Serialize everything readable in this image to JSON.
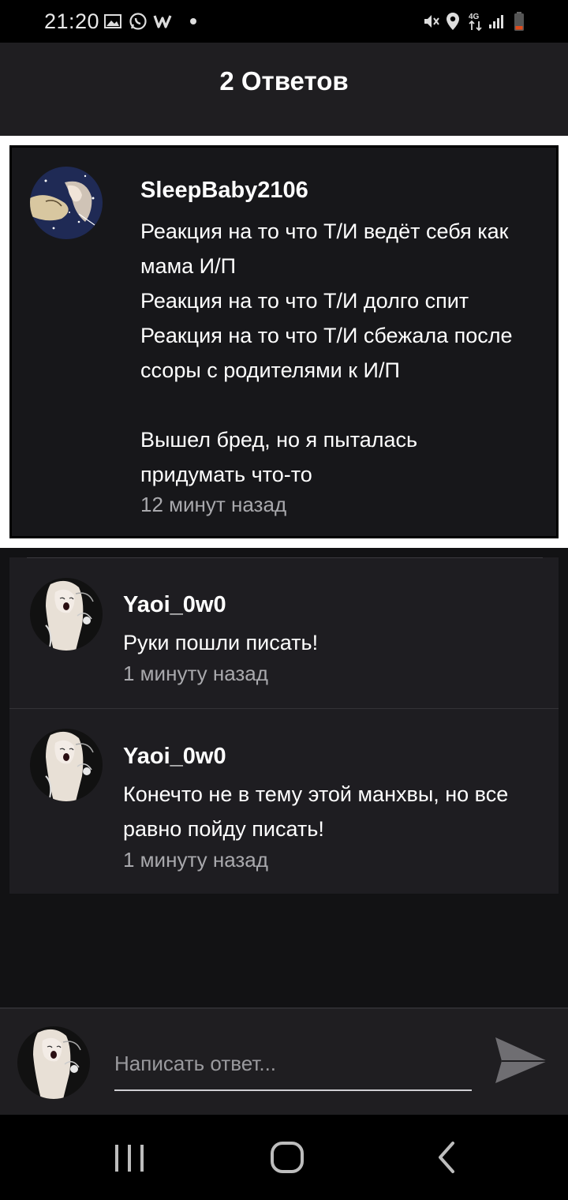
{
  "status_bar": {
    "time": "21:20",
    "left_icons": [
      "gallery-icon",
      "whatsapp-icon",
      "wattpad-icon",
      "notification-dot-icon"
    ],
    "right_icons": [
      "mute-icon",
      "location-icon",
      "4g-data-icon",
      "signal-icon",
      "battery-low-icon"
    ]
  },
  "header": {
    "title": "2 Ответов"
  },
  "original_comment": {
    "username": "SleepBaby2106",
    "lines": [
      "Реакция на то что Т/И ведёт себя как",
      "мама И/П",
      "Реакция на то что Т/И долго спит",
      "Реакция на то что Т/И сбежала после",
      "ссоры с родителями к И/П",
      "",
      "Вышел бред, но я пыталась",
      "придумать что-то"
    ],
    "time": "12 минут назад"
  },
  "replies": [
    {
      "username": "Yaoi_0w0",
      "lines": [
        "Руки пошли писать!"
      ],
      "time": "1 минуту назад"
    },
    {
      "username": "Yaoi_0w0",
      "lines": [
        "Конечто не в тему этой манхвы, но все",
        "равно пойду писать!"
      ],
      "time": "1 минуту назад"
    }
  ],
  "compose": {
    "placeholder": "Написать ответ..."
  },
  "nav": {
    "buttons": [
      "recent-apps-icon",
      "home-icon",
      "back-icon"
    ]
  },
  "colors": {
    "background": "#121214",
    "header": "#1f1e21",
    "card": "#17171a",
    "reply_card": "#1e1d21",
    "muted_text": "#a9a9ad"
  }
}
